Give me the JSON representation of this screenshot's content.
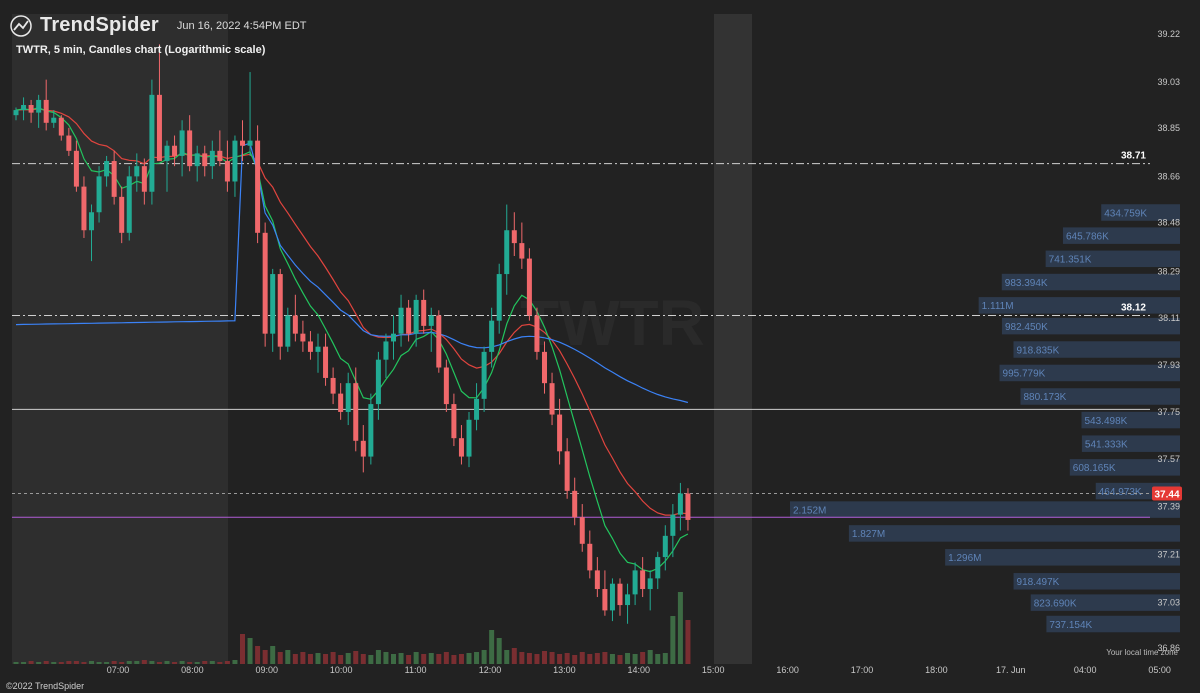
{
  "header": {
    "brand": "TrendSpider",
    "timestamp": "Jun 16, 2022 4:54PM EDT",
    "subtitle": "TWTR, 5 min, Candles chart (Logarithmic scale)",
    "copyright": "©2022 TrendSpider",
    "timezone_note": "Your local time zone"
  },
  "colors": {
    "background": "#222222",
    "extended_hours": "#2e2e2e",
    "up": "#22ab94",
    "down": "#f0686b",
    "ema_fast": "#22c55e",
    "ema_slow": "#e0443e",
    "vwap": "#3b82f6",
    "volume_profile": "#2f3e55",
    "current_price_badge": "#e53935"
  },
  "chart_data": {
    "type": "candlestick",
    "symbol": "TWTR",
    "interval": "5 min",
    "scale": "log",
    "ylim": [
      36.8,
      39.3
    ],
    "y_ticks": [
      "39.22",
      "39.03",
      "38.85",
      "38.66",
      "38.48",
      "38.29",
      "38.11",
      "37.93",
      "37.75",
      "37.57",
      "37.39",
      "37.21",
      "37.03",
      "36.86"
    ],
    "x_ticks": [
      "07:00",
      "08:00",
      "09:00",
      "10:00",
      "11:00",
      "12:00",
      "13:00",
      "14:00",
      "15:00",
      "16:00",
      "17:00",
      "18:00",
      "17. Jun",
      "04:00",
      "05:00"
    ],
    "grid": false,
    "horizontal_levels": [
      {
        "label": "38.71",
        "value": 38.71,
        "style": "dash-dot"
      },
      {
        "label": "38.12",
        "value": 38.12,
        "style": "dash-dot"
      },
      {
        "label": "",
        "value": 37.76,
        "style": "solid"
      },
      {
        "label": "37.44",
        "value": 37.44,
        "style": "dashed"
      },
      {
        "label": "",
        "value": 37.35,
        "style": "solid-purple"
      }
    ],
    "current_price": "37.44",
    "volume_profile": [
      {
        "price": 38.52,
        "volume": "434.759K"
      },
      {
        "price": 38.43,
        "volume": "645.786K"
      },
      {
        "price": 38.34,
        "volume": "741.351K"
      },
      {
        "price": 38.25,
        "volume": "983.394K"
      },
      {
        "price": 38.16,
        "volume": "1.111M"
      },
      {
        "price": 38.08,
        "volume": "982.450K"
      },
      {
        "price": 37.99,
        "volume": "918.835K"
      },
      {
        "price": 37.9,
        "volume": "995.779K"
      },
      {
        "price": 37.81,
        "volume": "880.173K"
      },
      {
        "price": 37.72,
        "volume": "543.498K"
      },
      {
        "price": 37.63,
        "volume": "541.333K"
      },
      {
        "price": 37.54,
        "volume": "608.165K"
      },
      {
        "price": 37.45,
        "volume": "464.973K"
      },
      {
        "price": 37.38,
        "volume": "2.152M"
      },
      {
        "price": 37.29,
        "volume": "1.827M"
      },
      {
        "price": 37.2,
        "volume": "1.296M"
      },
      {
        "price": 37.11,
        "volume": "918.497K"
      },
      {
        "price": 37.03,
        "volume": "823.690K"
      },
      {
        "price": 36.95,
        "volume": "737.154K"
      }
    ],
    "candles": [
      [
        38.9,
        38.93,
        38.88,
        38.92
      ],
      [
        38.92,
        38.97,
        38.88,
        38.94
      ],
      [
        38.94,
        38.96,
        38.87,
        38.91
      ],
      [
        38.91,
        38.98,
        38.85,
        38.96
      ],
      [
        38.96,
        39.04,
        38.84,
        38.87
      ],
      [
        38.87,
        38.92,
        38.85,
        38.89
      ],
      [
        38.89,
        38.9,
        38.8,
        38.82
      ],
      [
        38.82,
        38.85,
        38.74,
        38.76
      ],
      [
        38.76,
        38.8,
        38.6,
        38.62
      ],
      [
        38.62,
        38.66,
        38.42,
        38.45
      ],
      [
        38.45,
        38.55,
        38.33,
        38.52
      ],
      [
        38.52,
        38.7,
        38.48,
        38.66
      ],
      [
        38.66,
        38.74,
        38.62,
        38.72
      ],
      [
        38.72,
        38.76,
        38.55,
        38.58
      ],
      [
        38.58,
        38.62,
        38.4,
        38.44
      ],
      [
        38.44,
        38.7,
        38.41,
        38.66
      ],
      [
        38.66,
        38.75,
        38.6,
        38.7
      ],
      [
        38.7,
        38.73,
        38.55,
        38.6
      ],
      [
        38.6,
        39.04,
        38.55,
        38.98
      ],
      [
        38.98,
        39.18,
        38.8,
        38.72
      ],
      [
        38.72,
        38.8,
        38.6,
        38.78
      ],
      [
        38.78,
        38.82,
        38.7,
        38.74
      ],
      [
        38.74,
        38.88,
        38.66,
        38.84
      ],
      [
        38.84,
        38.9,
        38.68,
        38.7
      ],
      [
        38.7,
        38.78,
        38.64,
        38.75
      ],
      [
        38.75,
        38.78,
        38.66,
        38.7
      ],
      [
        38.7,
        38.8,
        38.65,
        38.76
      ],
      [
        38.76,
        38.84,
        38.7,
        38.72
      ],
      [
        38.72,
        38.8,
        38.6,
        38.64
      ],
      [
        38.64,
        38.82,
        38.58,
        38.8
      ],
      [
        38.8,
        38.88,
        38.72,
        38.78
      ],
      [
        38.78,
        39.07,
        38.74,
        38.8
      ],
      [
        38.8,
        38.86,
        38.4,
        38.44
      ],
      [
        38.44,
        38.48,
        38.0,
        38.05
      ],
      [
        38.05,
        38.3,
        37.98,
        38.28
      ],
      [
        38.28,
        38.3,
        37.95,
        38.0
      ],
      [
        38.0,
        38.15,
        37.98,
        38.12
      ],
      [
        38.12,
        38.2,
        38.02,
        38.05
      ],
      [
        38.05,
        38.1,
        37.98,
        38.02
      ],
      [
        38.02,
        38.06,
        37.95,
        37.98
      ],
      [
        37.98,
        38.05,
        37.9,
        38.0
      ],
      [
        38.0,
        38.05,
        37.85,
        37.88
      ],
      [
        37.88,
        37.92,
        37.78,
        37.82
      ],
      [
        37.82,
        37.86,
        37.72,
        37.75
      ],
      [
        37.75,
        37.9,
        37.7,
        37.86
      ],
      [
        37.86,
        37.92,
        37.6,
        37.64
      ],
      [
        37.64,
        37.7,
        37.52,
        37.58
      ],
      [
        37.58,
        37.82,
        37.55,
        37.78
      ],
      [
        37.78,
        37.98,
        37.72,
        37.95
      ],
      [
        37.95,
        38.05,
        37.88,
        38.02
      ],
      [
        38.02,
        38.12,
        37.95,
        38.05
      ],
      [
        38.05,
        38.2,
        38.0,
        38.15
      ],
      [
        38.15,
        38.18,
        38.02,
        38.05
      ],
      [
        38.05,
        38.2,
        38.0,
        38.18
      ],
      [
        38.18,
        38.22,
        38.05,
        38.08
      ],
      [
        38.08,
        38.15,
        37.98,
        38.12
      ],
      [
        38.12,
        38.14,
        37.9,
        37.92
      ],
      [
        37.92,
        37.95,
        37.75,
        37.78
      ],
      [
        37.78,
        37.82,
        37.62,
        37.65
      ],
      [
        37.65,
        37.7,
        37.55,
        37.58
      ],
      [
        37.58,
        37.75,
        37.54,
        37.72
      ],
      [
        37.72,
        37.86,
        37.68,
        37.8
      ],
      [
        37.8,
        38.0,
        37.75,
        37.98
      ],
      [
        37.98,
        38.15,
        37.92,
        38.1
      ],
      [
        38.1,
        38.32,
        38.05,
        38.28
      ],
      [
        38.28,
        38.55,
        38.2,
        38.45
      ],
      [
        38.45,
        38.52,
        38.35,
        38.4
      ],
      [
        38.4,
        38.48,
        38.3,
        38.34
      ],
      [
        38.34,
        38.38,
        38.1,
        38.12
      ],
      [
        38.12,
        38.15,
        37.95,
        37.98
      ],
      [
        37.98,
        38.02,
        37.82,
        37.86
      ],
      [
        37.86,
        37.9,
        37.7,
        37.74
      ],
      [
        37.74,
        37.8,
        37.55,
        37.6
      ],
      [
        37.6,
        37.65,
        37.42,
        37.45
      ],
      [
        37.45,
        37.5,
        37.32,
        37.35
      ],
      [
        37.35,
        37.4,
        37.22,
        37.25
      ],
      [
        37.25,
        37.3,
        37.12,
        37.15
      ],
      [
        37.15,
        37.2,
        37.05,
        37.08
      ],
      [
        37.08,
        37.15,
        36.98,
        37.0
      ],
      [
        37.0,
        37.12,
        36.96,
        37.1
      ],
      [
        37.1,
        37.12,
        36.98,
        37.02
      ],
      [
        37.02,
        37.1,
        36.95,
        37.06
      ],
      [
        37.06,
        37.18,
        37.02,
        37.15
      ],
      [
        37.15,
        37.2,
        37.05,
        37.08
      ],
      [
        37.08,
        37.15,
        37.0,
        37.12
      ],
      [
        37.12,
        37.22,
        37.08,
        37.2
      ],
      [
        37.2,
        37.32,
        37.15,
        37.28
      ],
      [
        37.28,
        37.4,
        37.2,
        37.36
      ],
      [
        37.36,
        37.48,
        37.3,
        37.44
      ],
      [
        37.44,
        37.46,
        37.3,
        37.34
      ]
    ],
    "volume_bars": [
      2,
      2,
      3,
      2,
      3,
      2,
      2,
      3,
      3,
      2,
      3,
      2,
      2,
      3,
      2,
      3,
      3,
      4,
      3,
      2,
      3,
      2,
      3,
      2,
      2,
      3,
      3,
      2,
      3,
      4,
      30,
      26,
      18,
      14,
      18,
      12,
      14,
      10,
      12,
      10,
      11,
      10,
      12,
      9,
      11,
      13,
      10,
      9,
      14,
      12,
      10,
      11,
      9,
      12,
      10,
      11,
      10,
      12,
      9,
      10,
      11,
      12,
      14,
      34,
      26,
      14,
      16,
      12,
      11,
      10,
      13,
      12,
      10,
      11,
      9,
      12,
      10,
      11,
      12,
      10,
      9,
      11,
      10,
      12,
      14,
      10,
      11,
      48,
      72,
      44
    ]
  }
}
